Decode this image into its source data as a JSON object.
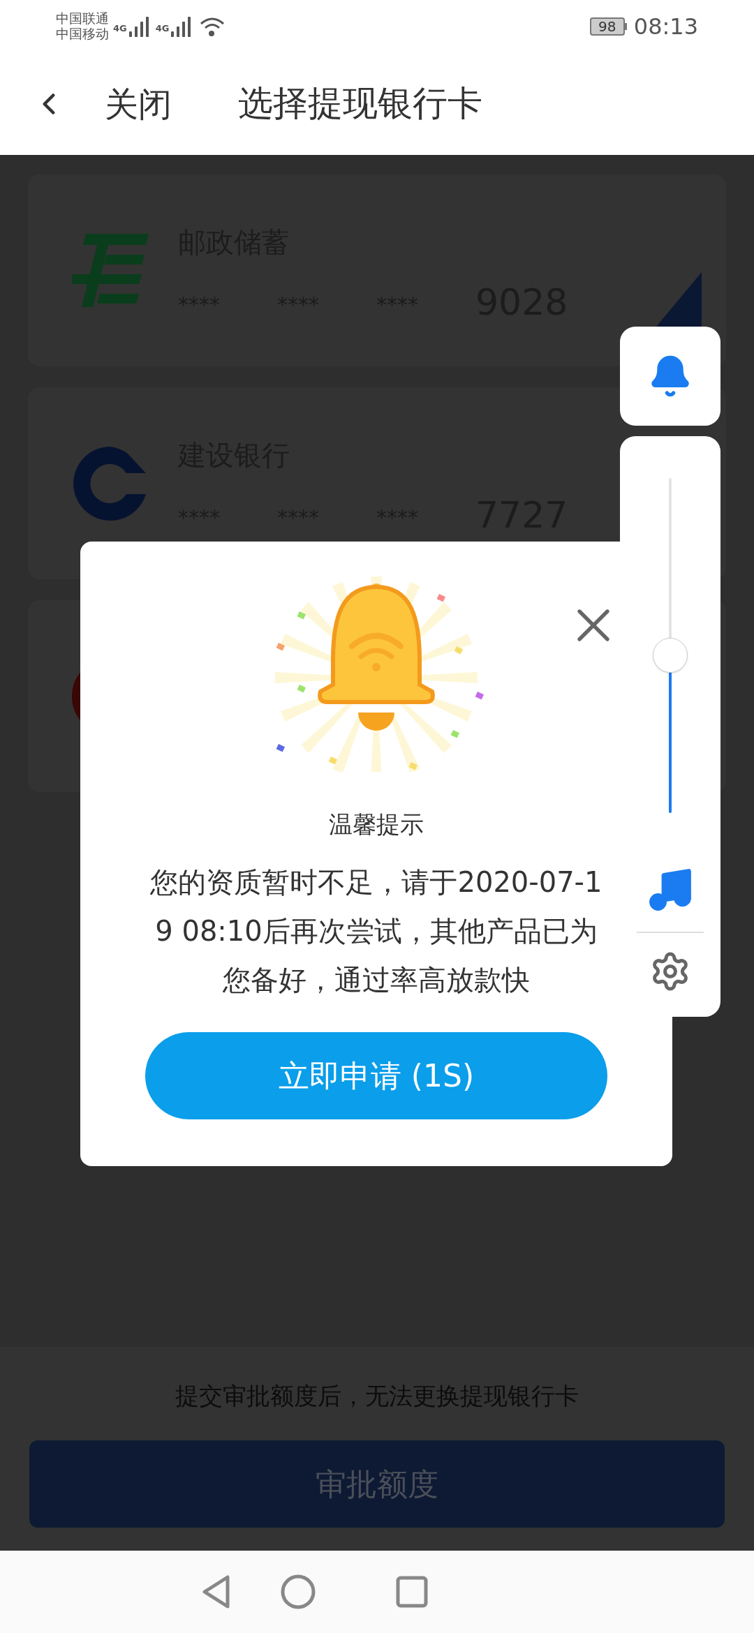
{
  "status_bar": {
    "carriers": [
      "中国联通",
      "中国移动"
    ],
    "network_labels": [
      "4G",
      "4G"
    ],
    "battery": "98",
    "time": "08:13"
  },
  "header": {
    "close": "关闭",
    "title": "选择提现银行卡"
  },
  "cards": [
    {
      "kind": "postal",
      "name": "邮政储蓄",
      "masked": [
        "****",
        "****",
        "****"
      ],
      "last4": "9028",
      "corner_mark": true
    },
    {
      "kind": "ccb",
      "name": "建设银行",
      "masked": [
        "****",
        "****",
        "****"
      ],
      "last4": "7727"
    },
    {
      "kind": "red-ring"
    }
  ],
  "footer": {
    "note": "提交审批额度后，无法更换提现银行卡",
    "button": "审批额度"
  },
  "dialog": {
    "title": "温馨提示",
    "message_lines": [
      "您的资质暂时不足，请于2020-07-1",
      "9 08:10后再次尝试，其他产品已为",
      "您备好，通过率高放款快"
    ],
    "button": "立即申请 (1S)"
  },
  "volume_panel": {
    "level": 0.47
  }
}
